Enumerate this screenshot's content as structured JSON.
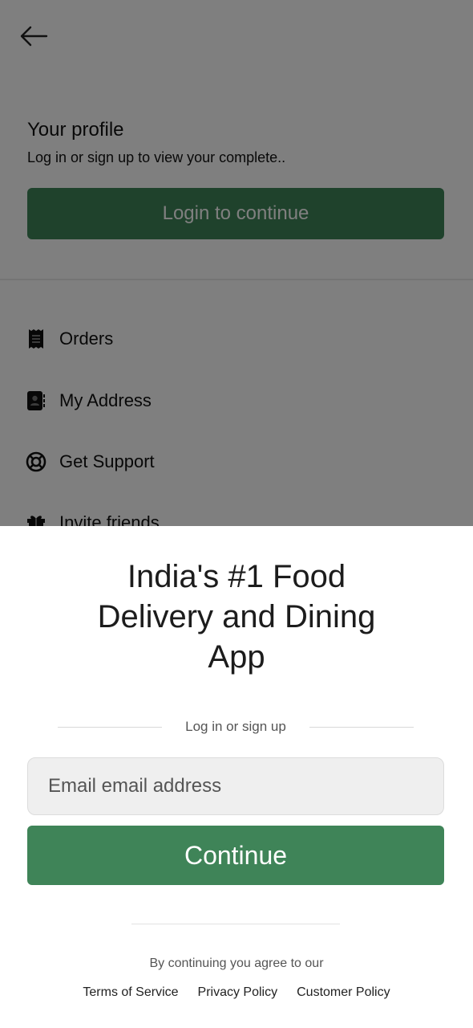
{
  "profile": {
    "title": "Your profile",
    "subtitle": "Log in or sign up to view your complete..",
    "login_button": "Login to continue"
  },
  "menu": {
    "items": [
      {
        "label": "Orders",
        "icon": "receipt-icon"
      },
      {
        "label": "My Address",
        "icon": "address-book-icon"
      },
      {
        "label": "Get Support",
        "icon": "lifebuoy-icon"
      },
      {
        "label": "Invite friends",
        "icon": "gift-icon"
      }
    ]
  },
  "sheet": {
    "headline": "India's #1 Food Delivery and Dining App",
    "separator_text": "Log in or sign up",
    "email_placeholder": "Email email address",
    "continue_button": "Continue",
    "agree_text": "By continuing you agree to our",
    "links": [
      "Terms of Service",
      "Privacy Policy",
      "Customer Policy"
    ]
  },
  "colors": {
    "accent": "#3f8458",
    "overlay": "rgba(0,0,0,0.5)"
  }
}
